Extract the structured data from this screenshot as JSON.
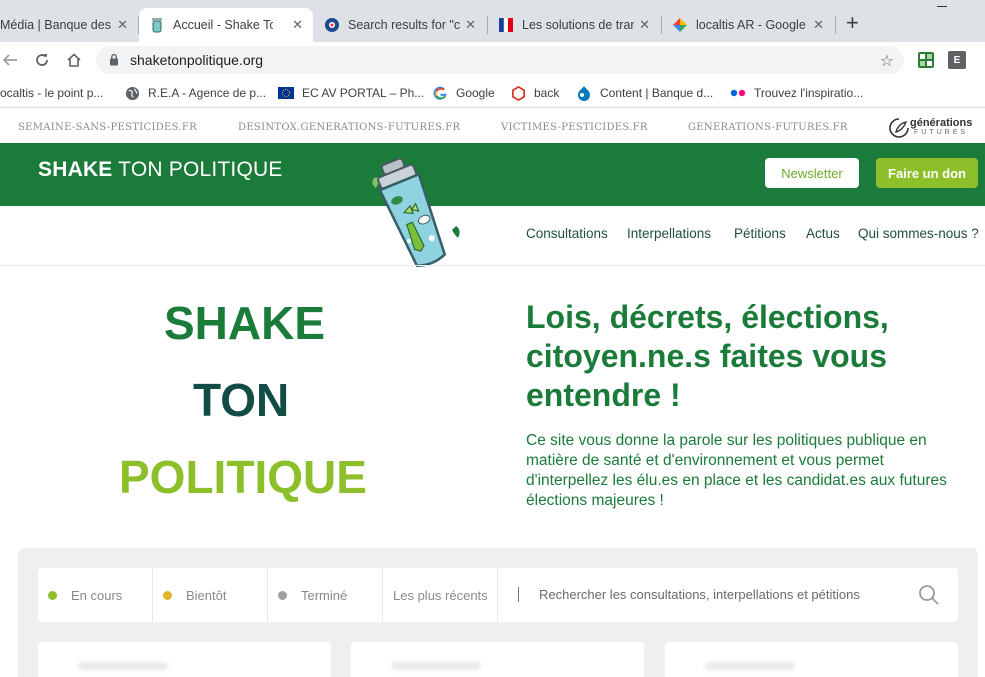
{
  "browser": {
    "tabs": [
      {
        "title": "Média | Banque des",
        "active": false
      },
      {
        "title": "Accueil - Shake Ton Politique",
        "active": true
      },
      {
        "title": "Search results for \"co",
        "active": false
      },
      {
        "title": "Les solutions de trans",
        "active": false
      },
      {
        "title": "localtis AR - Google",
        "active": false
      }
    ],
    "new_tab_label": "+",
    "url": "shaketonpolitique.org",
    "ext2_label": "E",
    "bookmarks": [
      "ocaltis - le point p...",
      "R.E.A - Agence de p...",
      "EC AV PORTAL – Ph...",
      "Google",
      "back",
      "Content | Banque d...",
      "Trouvez l'inspiratio..."
    ]
  },
  "page": {
    "top_links": [
      "SEMAINE-SANS-PESTICIDES.FR",
      "DESINTOX.GENERATIONS-FUTURES.FR",
      "VICTIMES-PESTICIDES.FR",
      "GENERATIONS-FUTURES.FR"
    ],
    "logo_text_1": "générations",
    "logo_text_2": "FUTURES",
    "brand_bold": "SHAKE",
    "brand_rest": " TON POLITIQUE",
    "newsletter_label": "Newsletter",
    "donate_label": "Faire un don",
    "nav": [
      "Consultations",
      "Interpellations",
      "Pétitions",
      "Actus",
      "Qui sommes-nous ?"
    ],
    "hero_words": [
      "SHAKE",
      "TON",
      "POLITIQUE"
    ],
    "headline": "Lois, décrets, élections, citoyen.ne.s faites vous entendre !",
    "intro": "Ce site vous donne la parole sur les politiques publique en matière de santé et d'environnement et vous permet d'interpellez les élu.es en place et les candidat.es aux futures élections majeures !",
    "filters": [
      {
        "label": "En cours",
        "color": "#8cbf2a"
      },
      {
        "label": "Bientôt",
        "color": "#e2b52a"
      },
      {
        "label": "Terminé",
        "color": "#a0a0a0"
      }
    ],
    "sort_label": "Les plus récents",
    "search_placeholder": "Rechercher les consultations, interpellations et pétitions"
  },
  "colors": {
    "brand_green": "#1b7b3a",
    "dark_teal": "#114d44",
    "lime": "#8cbf2a"
  }
}
